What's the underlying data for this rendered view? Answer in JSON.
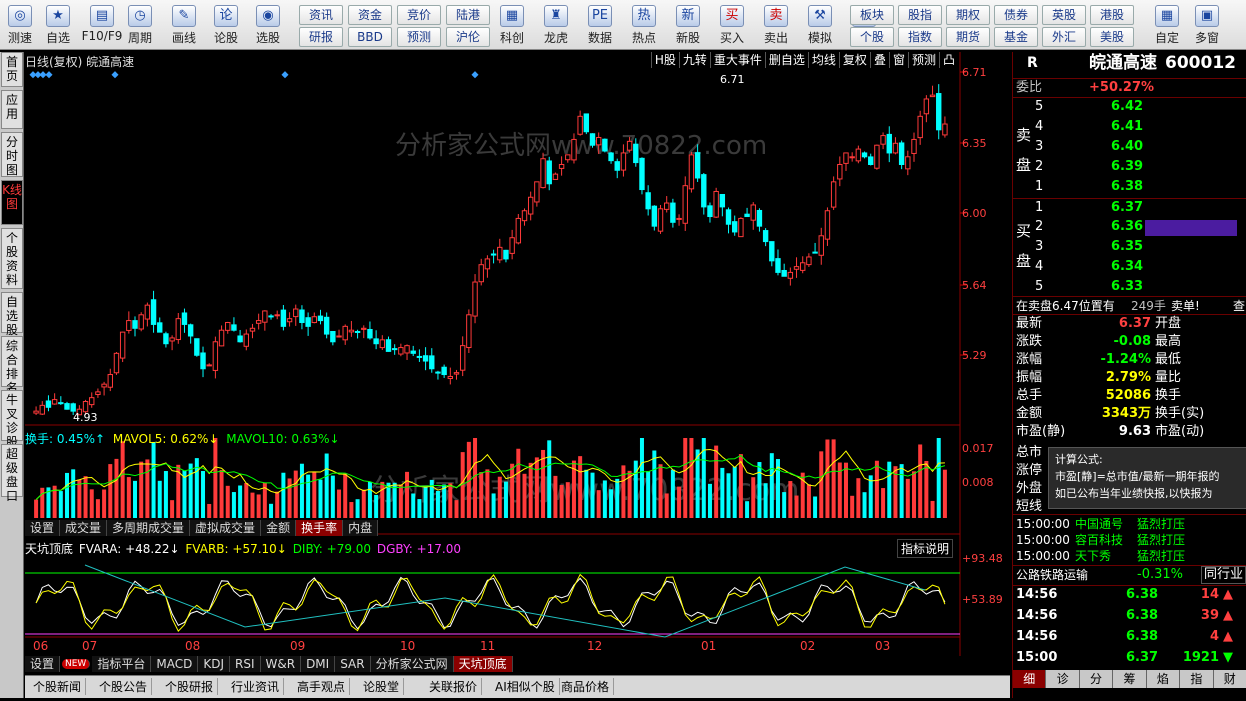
{
  "toolbar": {
    "items": [
      {
        "label": "测速",
        "icon": "speed-icon",
        "glyph": "◎"
      },
      {
        "label": "自选",
        "icon": "star-icon",
        "glyph": "★"
      },
      {
        "label": "F10/F9",
        "icon": "f10-icon",
        "glyph": "▤"
      },
      {
        "label": "周期",
        "icon": "clock-icon",
        "glyph": "◷"
      },
      {
        "label": "画线",
        "icon": "pencil-icon",
        "glyph": "✎"
      },
      {
        "label": "论股",
        "icon": "discuss-icon",
        "glyph": "论"
      },
      {
        "label": "选股",
        "icon": "select-icon",
        "glyph": "◉"
      }
    ],
    "grid1": [
      [
        "资讯",
        "资金",
        "竞价",
        "陆港"
      ],
      [
        "研报",
        "BBD",
        "预测",
        "沪伦"
      ]
    ],
    "mid": [
      {
        "label": "科创",
        "glyph": "▦"
      },
      {
        "label": "龙虎",
        "glyph": "♜"
      },
      {
        "label": "数据",
        "glyph": "PE"
      },
      {
        "label": "热点",
        "glyph": "热"
      },
      {
        "label": "新股",
        "glyph": "新"
      },
      {
        "label": "买入",
        "glyph": "买"
      },
      {
        "label": "卖出",
        "glyph": "卖"
      },
      {
        "label": "模拟",
        "glyph": "⚒"
      },
      {
        "label": "全球",
        "glyph": "◍"
      }
    ],
    "grid2": [
      [
        "板块",
        "股指",
        "期权",
        "债券",
        "英股",
        "港股"
      ],
      [
        "个股",
        "指数",
        "期货",
        "基金",
        "外汇",
        "美股"
      ]
    ],
    "right": [
      {
        "label": "自定",
        "glyph": "▦"
      },
      {
        "label": "多窗",
        "glyph": "▣"
      }
    ]
  },
  "left_tabs": [
    "首页",
    "应用",
    "分时图",
    "K线图",
    "个股资料",
    "自选股",
    "综合排名",
    "牛叉诊股",
    "超级盘口"
  ],
  "chart": {
    "header_left": "日线(复权) 皖通高速",
    "header_buttons": [
      "H股",
      "九转",
      "重大事件",
      "删自选",
      "均线",
      "复权",
      "叠",
      "窗",
      "预测",
      "凸"
    ],
    "price_axis": [
      "6.71",
      "6.35",
      "6.00",
      "5.64",
      "5.29"
    ],
    "max_label": "6.71",
    "min_label": "4.93",
    "watermark": "分析家公式网www.70822.com"
  },
  "chart_data": {
    "type": "candlestick",
    "ylim": [
      4.93,
      6.71
    ],
    "close": [
      4.95,
      4.98,
      4.97,
      5.01,
      4.99,
      4.96,
      4.95,
      4.96,
      5.0,
      5.02,
      5.05,
      5.09,
      5.14,
      5.25,
      5.36,
      5.42,
      5.38,
      5.45,
      5.5,
      5.4,
      5.36,
      5.3,
      5.33,
      5.43,
      5.4,
      5.34,
      5.24,
      5.17,
      5.19,
      5.31,
      5.37,
      5.41,
      5.37,
      5.31,
      5.35,
      5.38,
      5.42,
      5.47,
      5.44,
      5.45,
      5.39,
      5.43,
      5.48,
      5.41,
      5.39,
      5.44,
      5.42,
      5.35,
      5.31,
      5.34,
      5.39,
      5.37,
      5.36,
      5.38,
      5.33,
      5.3,
      5.32,
      5.26,
      5.27,
      5.28,
      5.29,
      5.25,
      5.23,
      5.21,
      5.17,
      5.15,
      5.14,
      5.13,
      5.15,
      5.29,
      5.45,
      5.62,
      5.71,
      5.74,
      5.76,
      5.8,
      5.74,
      5.85,
      5.95,
      5.99,
      6.06,
      6.14,
      6.26,
      6.13,
      6.18,
      6.23,
      6.28,
      6.36,
      6.48,
      6.4,
      6.33,
      6.37,
      6.3,
      6.25,
      6.2,
      6.29,
      6.35,
      6.24,
      6.1,
      6.0,
      5.91,
      6.0,
      6.03,
      5.93,
      5.95,
      6.12,
      6.28,
      6.16,
      6.01,
      5.96,
      6.09,
      6.01,
      5.92,
      5.88,
      5.95,
      5.96,
      6.02,
      5.91,
      5.83,
      5.73,
      5.67,
      5.65,
      5.67,
      5.7,
      5.72,
      5.75,
      5.77,
      5.86,
      5.99,
      6.14,
      6.23,
      6.29,
      6.27,
      6.31,
      6.27,
      6.23,
      6.33,
      6.38,
      6.29,
      6.34,
      6.23,
      6.27,
      6.36,
      6.48,
      6.57,
      6.59,
      6.41,
      6.44
    ],
    "volume_series": [
      "换手",
      "MAVOL5",
      "MAVOL10"
    ],
    "volume_axis": [
      "0.017",
      "0.008"
    ],
    "indicator_series": [
      "FVARA",
      "FVARB",
      "DIBY",
      "DGBY"
    ],
    "indicator_axis": [
      "+93.48",
      "+53.89"
    ],
    "x_labels": [
      "06",
      "07",
      "08",
      "09",
      "10",
      "11",
      "12",
      "01",
      "02",
      "03"
    ]
  },
  "vol_legend": {
    "l1": "换手: 0.45%↑",
    "l2": "MAVOL5: 0.62%↓",
    "l3": "MAVOL10: 0.63%↓"
  },
  "vol_tabs": [
    "设置",
    "成交量",
    "多周期成交量",
    "虚拟成交量",
    "金额",
    "换手率",
    "内盘"
  ],
  "ind_legend": {
    "name": "天坑顶底",
    "a": "FVARA: +48.22↓",
    "b": "FVARB: +57.10↓",
    "c": "DIBY: +79.00",
    "d": "DGBY: +17.00",
    "btn": "指标说明"
  },
  "ind_tabs": [
    "设置",
    "指标平台",
    "MACD",
    "KDJ",
    "RSI",
    "W&R",
    "DMI",
    "SAR",
    "分析家公式网",
    "天坑顶底"
  ],
  "new_badge": "NEW",
  "bottom_tabs": [
    "个股新闻",
    "个股公告",
    "个股研报",
    "行业资讯",
    "高手观点",
    "论股堂",
    "关联报价",
    "AI相似个股",
    "商品价格"
  ],
  "quote": {
    "flag": "R",
    "name": "皖通高速",
    "code": "600012",
    "weibi_label": "委比",
    "weibi": "+50.27%",
    "sell_label": "卖盘",
    "buy_label": "买盘",
    "sell": [
      [
        "5",
        "6.42"
      ],
      [
        "4",
        "6.41"
      ],
      [
        "3",
        "6.40"
      ],
      [
        "2",
        "6.39"
      ],
      [
        "1",
        "6.38"
      ]
    ],
    "buy": [
      [
        "1",
        "6.37"
      ],
      [
        "2",
        "6.36"
      ],
      [
        "3",
        "6.35"
      ],
      [
        "4",
        "6.34"
      ],
      [
        "5",
        "6.33"
      ]
    ],
    "notice": "在卖盘6.47位置有",
    "notice_vol": "249手",
    "notice_tag": "卖单!",
    "notice_more": "查",
    "stats": [
      [
        "最新",
        "6.37",
        "开盘"
      ],
      [
        "涨跌",
        "-0.08",
        "最高"
      ],
      [
        "涨幅",
        "-1.24%",
        "最低"
      ],
      [
        "振幅",
        "2.79%",
        "量比"
      ],
      [
        "总手",
        "52086",
        "换手"
      ],
      [
        "金额",
        "3343万",
        "换手(实)"
      ],
      [
        "市盈(静)",
        "9.63",
        "市盈(动)"
      ]
    ],
    "hidden_labels": [
      "总市",
      "涨停",
      "外盘",
      "短线"
    ],
    "tooltip_title": "计算公式:",
    "tooltip_l1": "市盈[静]=总市值/最新一期年报的",
    "tooltip_l2": "如已公布当年业绩快报,以快报为",
    "alerts": [
      [
        "15:00:00",
        "中国通号",
        "猛烈打压"
      ],
      [
        "15:00:00",
        "容百科技",
        "猛烈打压"
      ],
      [
        "15:00:00",
        "天下秀",
        "猛烈打压"
      ]
    ],
    "sector": "公路铁路运输",
    "sector_pct": "-0.31%",
    "sector_btn": "同行业",
    "ticks": [
      [
        "14:56",
        "6.38",
        "14",
        "up"
      ],
      [
        "14:56",
        "6.38",
        "39",
        "up"
      ],
      [
        "14:56",
        "6.38",
        "4",
        "up"
      ],
      [
        "15:00",
        "6.37",
        "1921",
        "down"
      ]
    ],
    "tabs": [
      "细",
      "诊",
      "分",
      "筹",
      "焰",
      "指",
      "财"
    ]
  }
}
